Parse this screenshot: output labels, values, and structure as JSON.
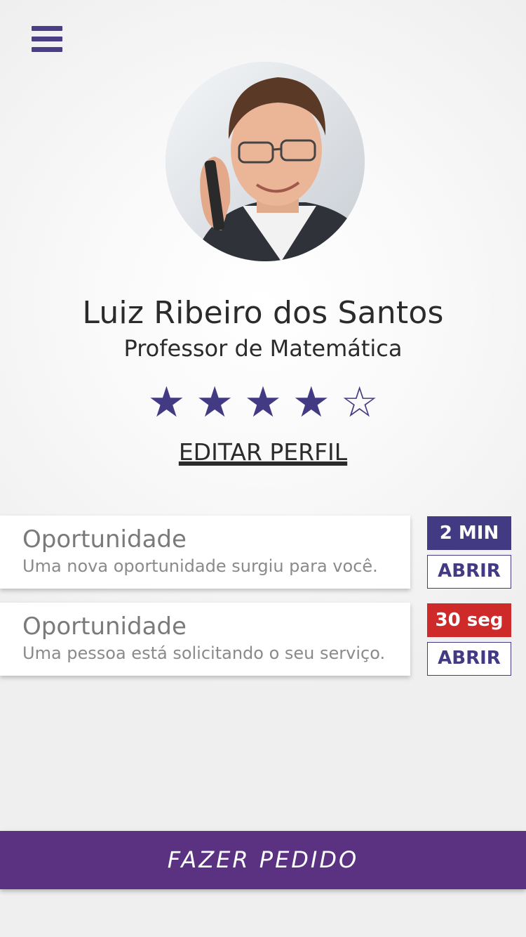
{
  "header": {
    "menu_icon": "hamburger-menu-icon"
  },
  "profile": {
    "name": "Luiz Ribeiro dos Santos",
    "role": "Professor de Matemática",
    "rating": 4,
    "rating_max": 5,
    "stars": [
      "★",
      "★",
      "★",
      "★",
      "☆"
    ],
    "edit_label": "EDITAR PERFIL"
  },
  "opportunities": [
    {
      "title": "Oportunidade",
      "description": "Uma nova oportunidade surgiu para você.",
      "timer": "2 MIN",
      "timer_color": "#433a84",
      "action_label": "ABRIR"
    },
    {
      "title": "Oportunidade",
      "description": "Uma pessoa está solicitando o seu serviço.",
      "timer": "30 seg",
      "timer_color": "#cf2a2a",
      "action_label": "ABRIR"
    }
  ],
  "footer": {
    "action_label": "FAZER PEDIDO"
  },
  "colors": {
    "accent": "#433a84",
    "footer": "#5b3282",
    "urgent": "#cf2a2a"
  }
}
